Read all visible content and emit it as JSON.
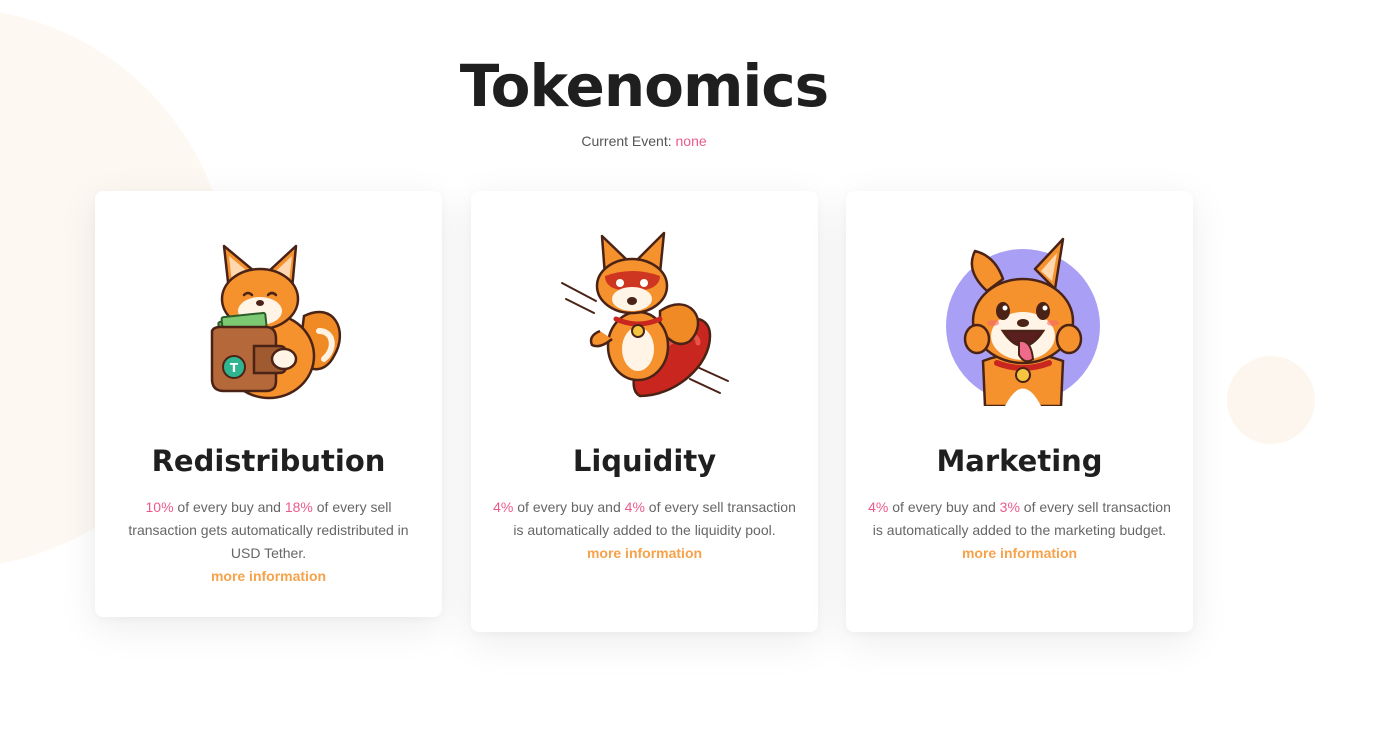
{
  "header": {
    "title": "Tokenomics",
    "event_label": "Current Event: ",
    "event_value": "none"
  },
  "cards": [
    {
      "illustration": "shiba-wallet-icon",
      "title": "Redistribution",
      "buy_pct": "10%",
      "mid1": " of every buy and ",
      "sell_pct": "18%",
      "rest": " of every sell transaction gets automatically redistributed in USD Tether.",
      "link": "more information"
    },
    {
      "illustration": "shiba-rocket-icon",
      "title": "Liquidity",
      "buy_pct": "4%",
      "mid1": " of every buy and ",
      "sell_pct": "4%",
      "rest": " of every sell transaction is automatically added to the liquidity pool.",
      "link": "more information"
    },
    {
      "illustration": "shiba-happy-icon",
      "title": "Marketing",
      "buy_pct": "4%",
      "mid1": " of every buy and ",
      "sell_pct": "3%",
      "rest": " of every sell transaction is automatically added to the marketing budget.",
      "link": "more information"
    }
  ],
  "colors": {
    "accent_pink": "#ec5a8c",
    "link_orange": "#f6a24a",
    "title_dark": "#1f1f1f"
  }
}
